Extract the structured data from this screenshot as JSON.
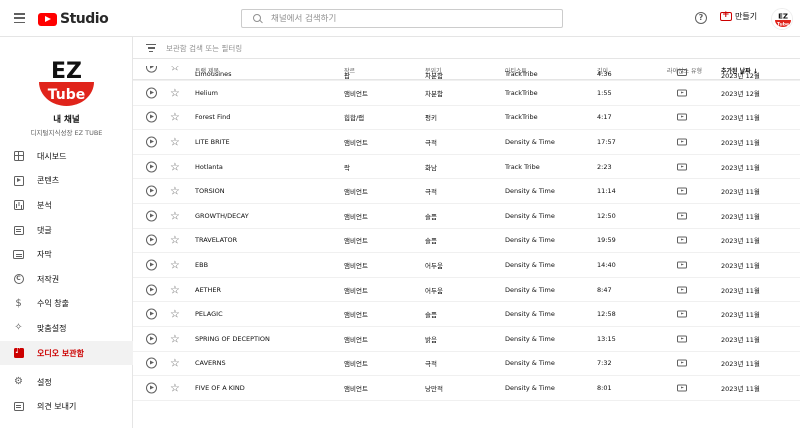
{
  "header": {
    "logo_text": "Studio",
    "search_placeholder": "채널에서 검색하기",
    "help_icon": "help-circle-icon",
    "create_label": "만들기"
  },
  "sidebar": {
    "channel_name": "내 채널",
    "channel_handle": "디지털지식성장 EZ TUBE",
    "logo_text_top": "EZ",
    "logo_text_bottom": "Tube",
    "items": [
      {
        "label": "대시보드",
        "icon": "dashboard-icon"
      },
      {
        "label": "콘텐츠",
        "icon": "content-icon"
      },
      {
        "label": "분석",
        "icon": "analytics-icon"
      },
      {
        "label": "댓글",
        "icon": "comments-icon"
      },
      {
        "label": "자막",
        "icon": "subtitles-icon"
      },
      {
        "label": "저작권",
        "icon": "copyright-icon"
      },
      {
        "label": "수익 창출",
        "icon": "monetization-icon"
      },
      {
        "label": "맞춤설정",
        "icon": "customization-icon"
      },
      {
        "label": "오디오 보관함",
        "icon": "audio-library-icon"
      }
    ],
    "bottom_items": [
      {
        "label": "설정",
        "icon": "settings-icon"
      },
      {
        "label": "의견 보내기",
        "icon": "feedback-icon"
      }
    ],
    "accent_color": "#cc0000"
  },
  "main": {
    "filter_placeholder": "보관함 검색 또는 필터링",
    "columns": {
      "title": "트랙 제목",
      "genre": "장르",
      "mood": "분위기",
      "artist": "아티스트",
      "duration": "길이",
      "license": "라이선스 유형",
      "date": "추가된 날짜",
      "sort_arrow": "↓"
    },
    "partial_row": {
      "title": "Limousines",
      "genre": "팝",
      "mood": "차분함",
      "artist": "TrackTribe",
      "duration": "4:36",
      "date": "2023년 12월"
    },
    "rows": [
      {
        "title": "Helium",
        "genre": "앰비언트",
        "mood": "차분함",
        "artist": "TrackTribe",
        "duration": "1:55",
        "date": "2023년 12월"
      },
      {
        "title": "Forest Find",
        "genre": "힙합/랩",
        "mood": "펑키",
        "artist": "TrackTribe",
        "duration": "4:17",
        "date": "2023년 11월"
      },
      {
        "title": "LITE BRITE",
        "genre": "앰비언트",
        "mood": "극적",
        "artist": "Density & Time",
        "duration": "17:57",
        "date": "2023년 11월"
      },
      {
        "title": "Hotlanta",
        "genre": "락",
        "mood": "화남",
        "artist": "Track Tribe",
        "duration": "2:23",
        "date": "2023년 11월"
      },
      {
        "title": "TORSION",
        "genre": "앰비언트",
        "mood": "극적",
        "artist": "Density & Time",
        "duration": "11:14",
        "date": "2023년 11월"
      },
      {
        "title": "GROWTH/DECAY",
        "genre": "앰비언트",
        "mood": "슬픔",
        "artist": "Density & Time",
        "duration": "12:50",
        "date": "2023년 11월"
      },
      {
        "title": "TRAVELATOR",
        "genre": "앰비언트",
        "mood": "슬픔",
        "artist": "Density & Time",
        "duration": "19:59",
        "date": "2023년 11월"
      },
      {
        "title": "EBB",
        "genre": "앰비언트",
        "mood": "어두움",
        "artist": "Density & Time",
        "duration": "14:40",
        "date": "2023년 11월"
      },
      {
        "title": "AETHER",
        "genre": "앰비언트",
        "mood": "어두움",
        "artist": "Density & Time",
        "duration": "8:47",
        "date": "2023년 11월"
      },
      {
        "title": "PELAGIC",
        "genre": "앰비언트",
        "mood": "슬픔",
        "artist": "Density & Time",
        "duration": "12:58",
        "date": "2023년 11월"
      },
      {
        "title": "SPRING OF DECEPTION",
        "genre": "앰비언트",
        "mood": "밝음",
        "artist": "Density & Time",
        "duration": "13:15",
        "date": "2023년 11월"
      },
      {
        "title": "CAVERNS",
        "genre": "앰비언트",
        "mood": "극적",
        "artist": "Density & Time",
        "duration": "7:32",
        "date": "2023년 11월"
      },
      {
        "title": "FIVE OF A KIND",
        "genre": "앰비언트",
        "mood": "낭만적",
        "artist": "Density & Time",
        "duration": "8:01",
        "date": "2023년 11월"
      }
    ]
  }
}
